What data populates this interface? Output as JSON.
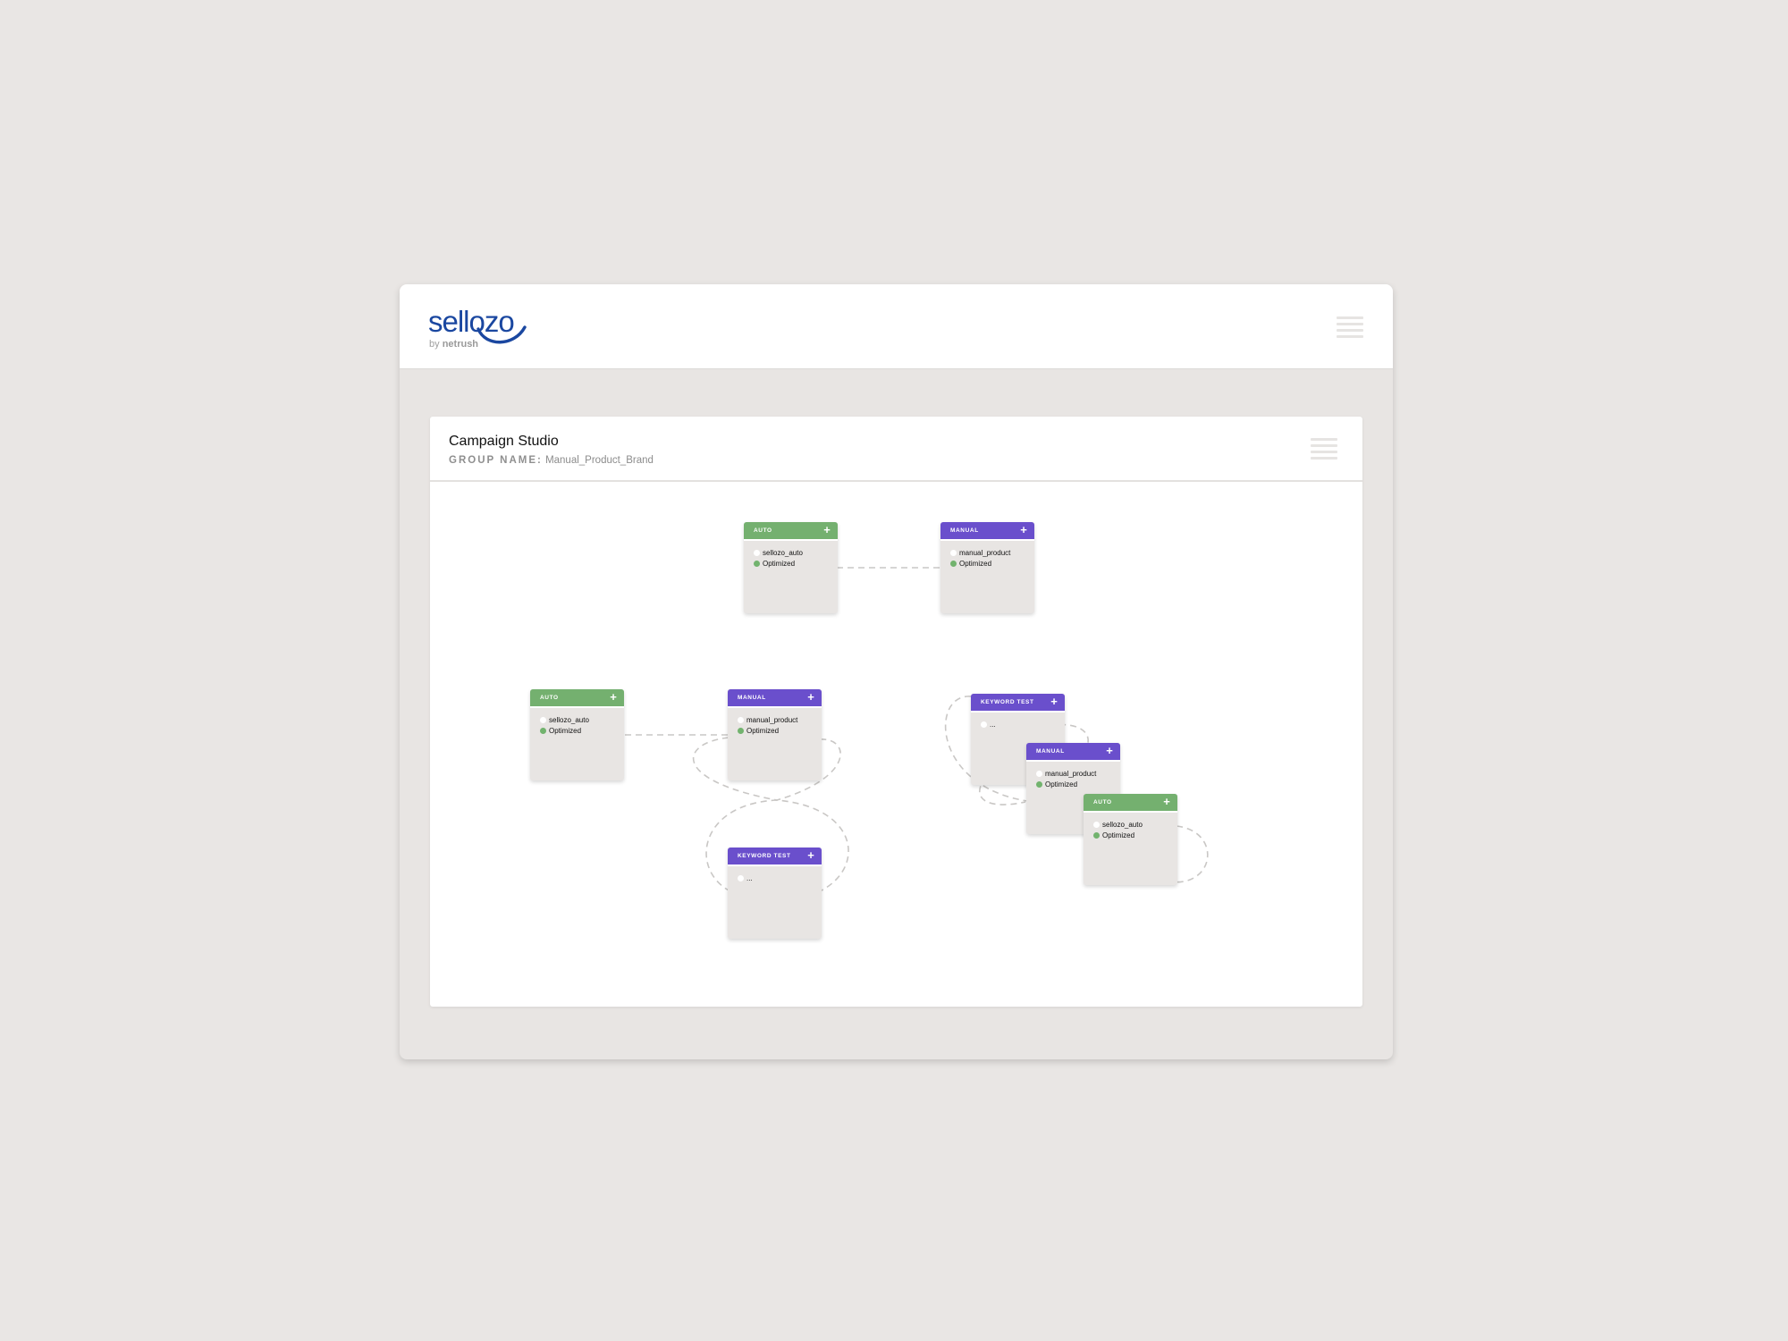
{
  "brand": {
    "name": "sellozo",
    "by_prefix": "by",
    "by_name": "netrush",
    "primary_color": "#1a47a0"
  },
  "header": {
    "menu_icon": "hamburger-menu-icon"
  },
  "panel": {
    "title": "Campaign Studio",
    "group_label": "GROUP NAME:",
    "group_value": "Manual_Product_Brand",
    "menu_icon": "hamburger-menu-icon"
  },
  "colors": {
    "auto": "#74b06f",
    "manual": "#6a4fcc",
    "keyword_test": "#6a4fcc",
    "optimized": "#72b36e",
    "link": "#c9c7c5"
  },
  "nodes": [
    {
      "type": "AUTO",
      "kind": "auto",
      "rows": [
        {
          "text": "sellozo_auto",
          "status": "empty"
        },
        {
          "text": "Optimized",
          "status": "ok"
        }
      ]
    },
    {
      "type": "MANUAL",
      "kind": "manual",
      "rows": [
        {
          "text": "manual_product",
          "status": "empty"
        },
        {
          "text": "Optimized",
          "status": "ok"
        }
      ]
    },
    {
      "type": "AUTO",
      "kind": "auto",
      "rows": [
        {
          "text": "sellozo_auto",
          "status": "empty"
        },
        {
          "text": "Optimized",
          "status": "ok"
        }
      ]
    },
    {
      "type": "MANUAL",
      "kind": "manual",
      "rows": [
        {
          "text": "manual_product",
          "status": "empty"
        },
        {
          "text": "Optimized",
          "status": "ok"
        }
      ]
    },
    {
      "type": "KEYWORD TEST",
      "kind": "keyword_test",
      "rows": [
        {
          "text": "...",
          "status": "empty"
        }
      ]
    },
    {
      "type": "KEYWORD TEST",
      "kind": "keyword_test",
      "rows": [
        {
          "text": "...",
          "status": "empty"
        }
      ]
    },
    {
      "type": "MANUAL",
      "kind": "manual",
      "rows": [
        {
          "text": "manual_product",
          "status": "empty"
        },
        {
          "text": "Optimized",
          "status": "ok"
        }
      ]
    },
    {
      "type": "AUTO",
      "kind": "auto",
      "rows": [
        {
          "text": "sellozo_auto",
          "status": "empty"
        },
        {
          "text": "Optimized",
          "status": "ok"
        }
      ]
    }
  ],
  "add_symbol": "+"
}
